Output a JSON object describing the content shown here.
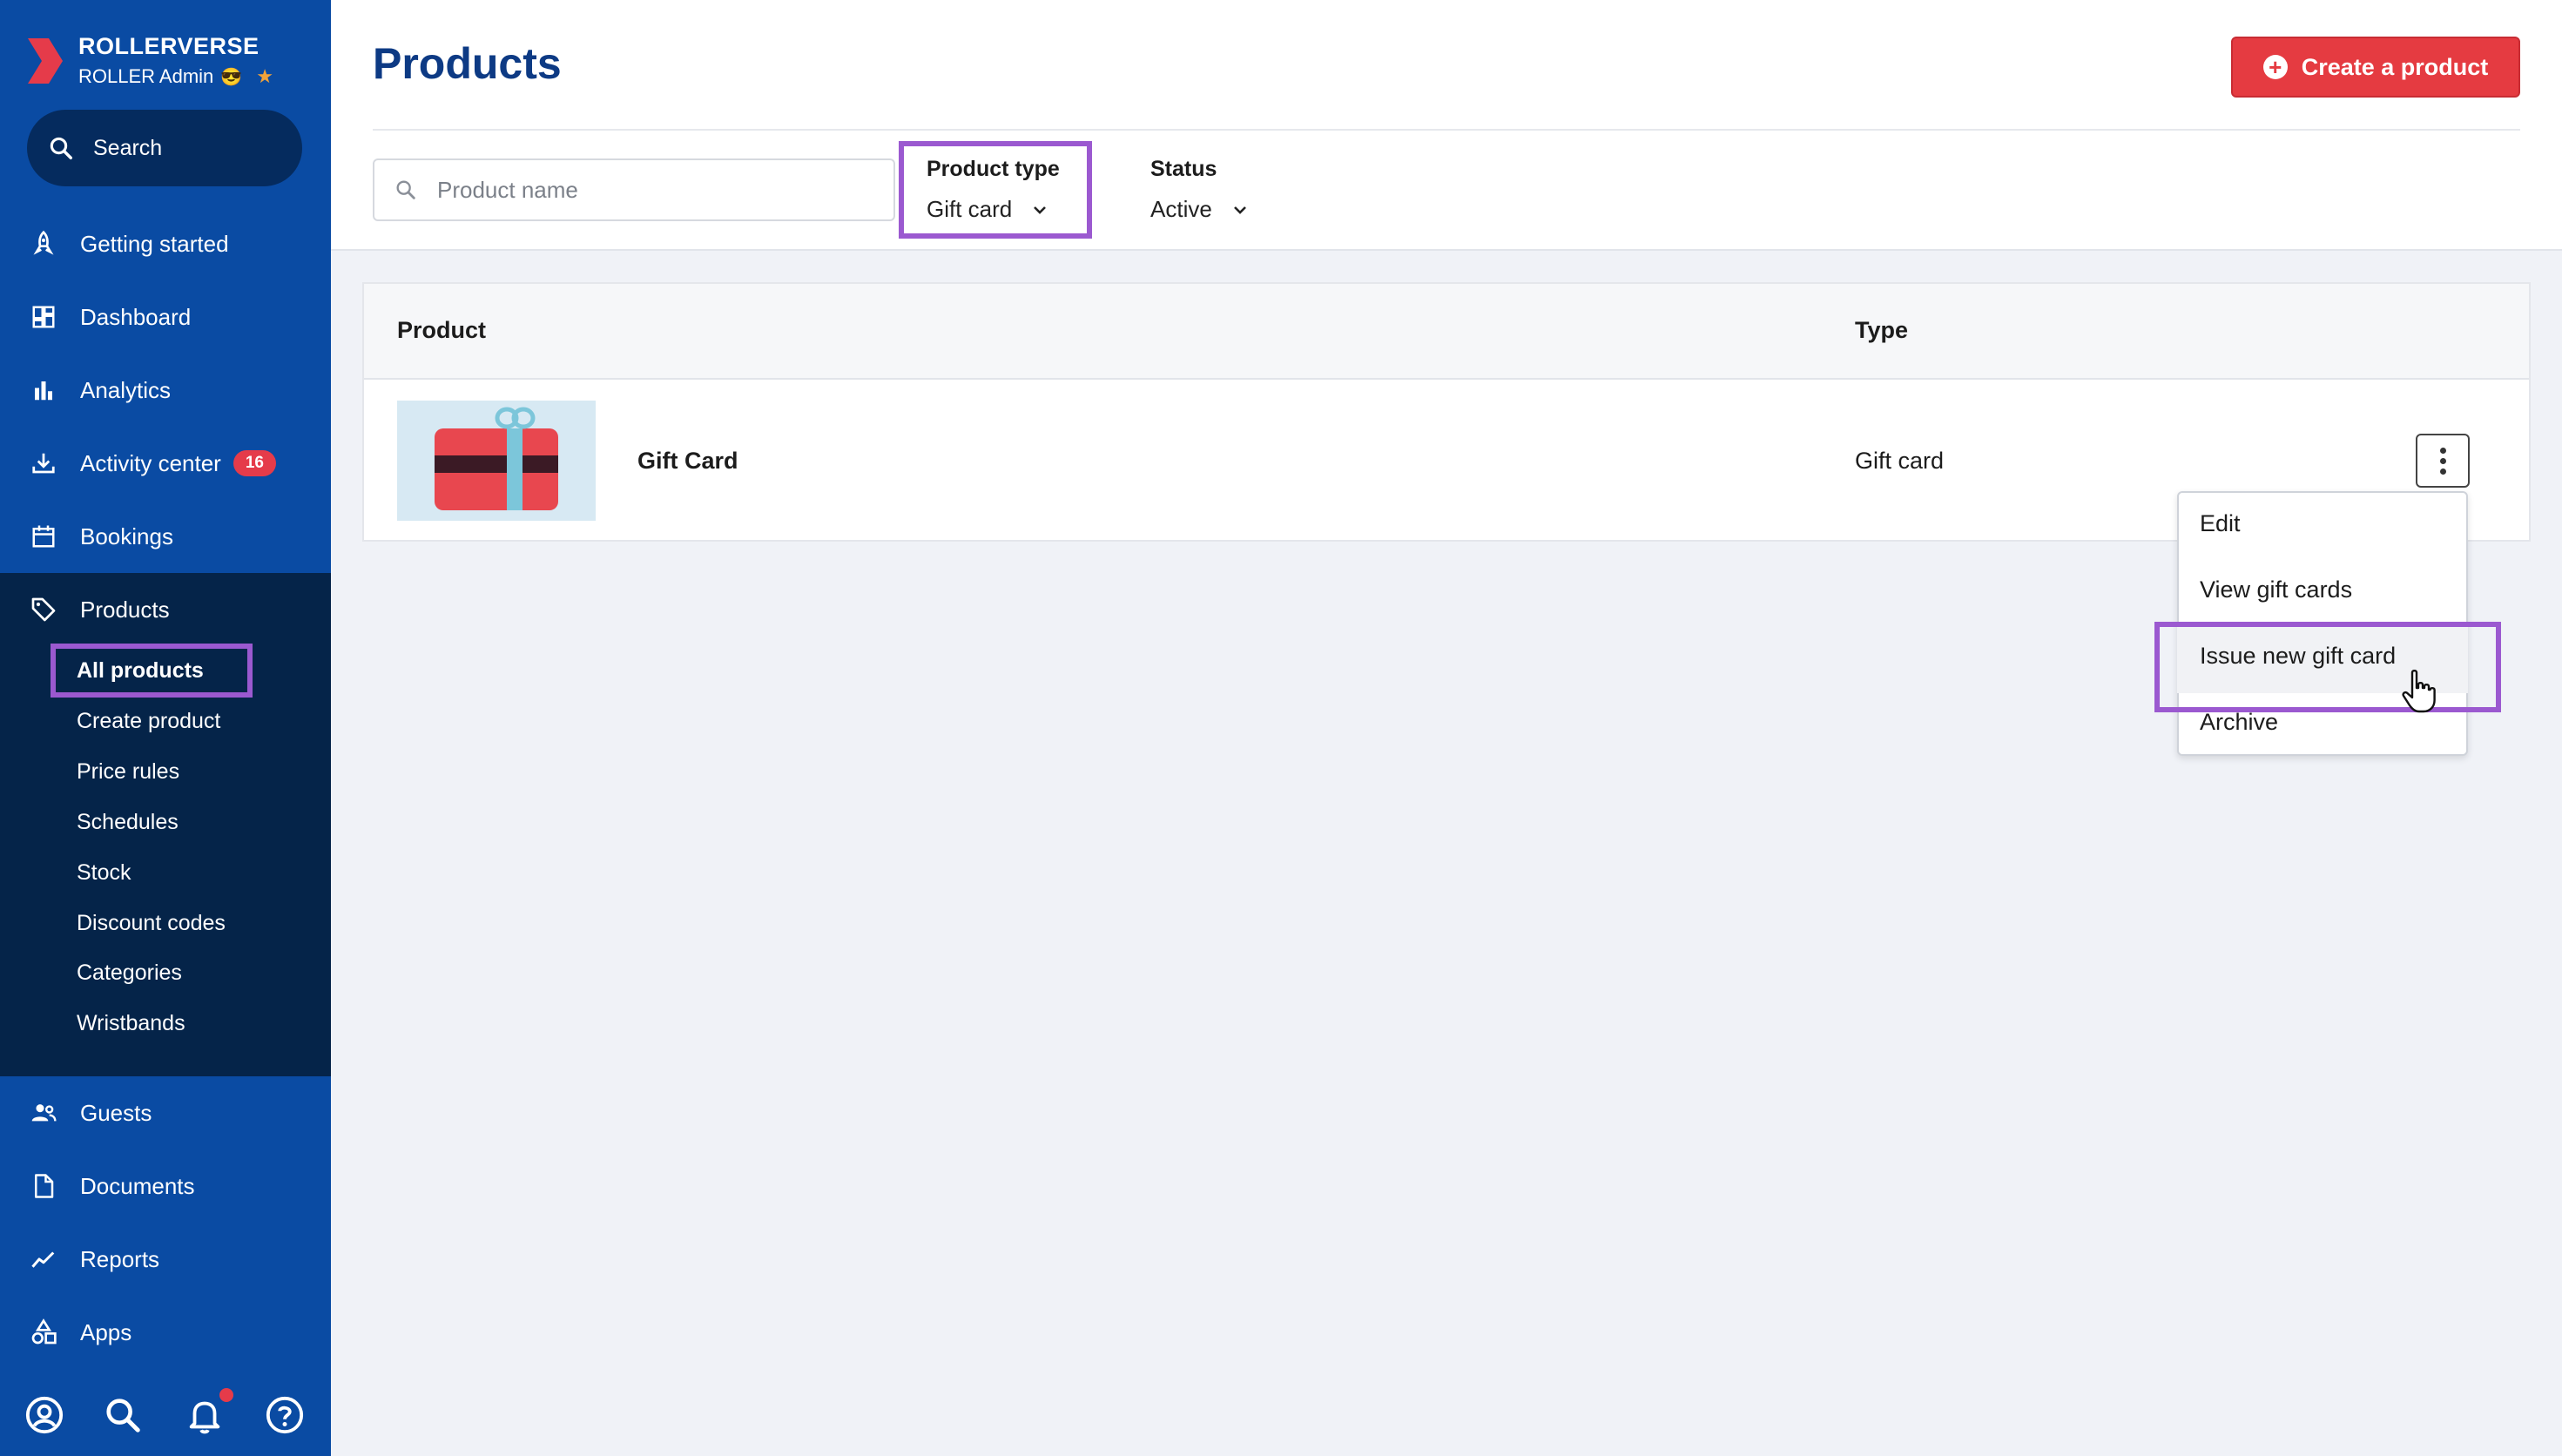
{
  "brand": {
    "name": "ROLLERVERSE",
    "subtitle": "ROLLER Admin",
    "emoji": "😎",
    "star": "★"
  },
  "sidebar": {
    "search_label": "Search",
    "items": [
      {
        "label": "Getting started",
        "icon": "rocket-icon"
      },
      {
        "label": "Dashboard",
        "icon": "dashboard-icon"
      },
      {
        "label": "Analytics",
        "icon": "bar-chart-icon"
      },
      {
        "label": "Activity center",
        "icon": "download-tray-icon",
        "badge": "16"
      },
      {
        "label": "Bookings",
        "icon": "calendar-icon"
      },
      {
        "label": "Products",
        "icon": "tag-icon"
      },
      {
        "label": "Guests",
        "icon": "people-icon"
      },
      {
        "label": "Documents",
        "icon": "document-icon"
      },
      {
        "label": "Reports",
        "icon": "trend-line-icon"
      },
      {
        "label": "Apps",
        "icon": "shapes-icon"
      }
    ],
    "products_sub": [
      {
        "label": "All products",
        "active": true
      },
      {
        "label": "Create product"
      },
      {
        "label": "Price rules"
      },
      {
        "label": "Schedules"
      },
      {
        "label": "Stock"
      },
      {
        "label": "Discount codes"
      },
      {
        "label": "Categories"
      },
      {
        "label": "Wristbands"
      }
    ],
    "bottom_icons": [
      "account-icon",
      "search-icon",
      "bell-icon",
      "help-icon"
    ]
  },
  "header": {
    "title": "Products",
    "create_button": "Create a product",
    "search_placeholder": "Product name",
    "filters": [
      {
        "label": "Product type",
        "value": "Gift card"
      },
      {
        "label": "Status",
        "value": "Active"
      }
    ]
  },
  "table": {
    "columns": [
      "Product",
      "Type"
    ],
    "rows": [
      {
        "name": "Gift Card",
        "type": "Gift card"
      }
    ]
  },
  "row_menu": {
    "items": [
      "Edit",
      "View gift cards",
      "Issue new gift card",
      "Archive"
    ],
    "hovered": "Issue new gift card"
  },
  "colors": {
    "sidebar": "#0a4ba3",
    "sidebar_active_block": "#052449",
    "accent_red": "#e53b41",
    "highlight": "#9b59d0",
    "title": "#0d3a84"
  }
}
